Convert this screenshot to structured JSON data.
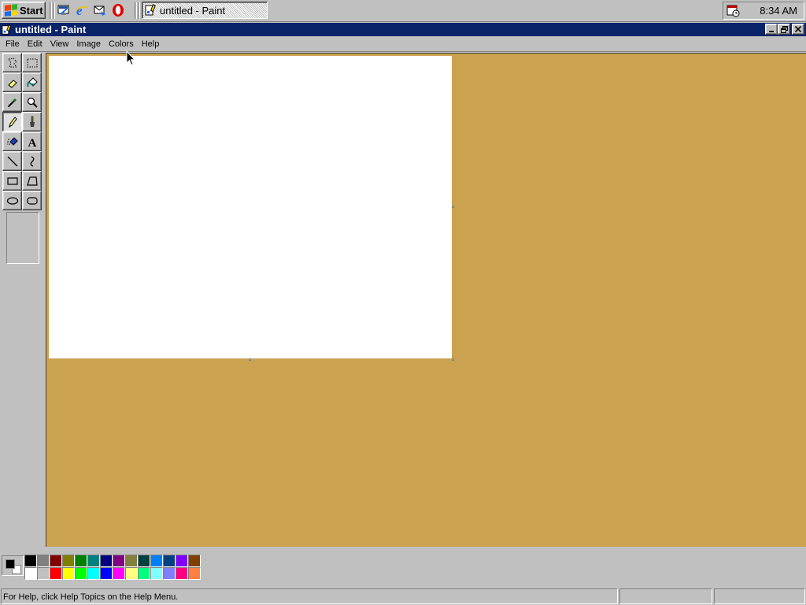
{
  "taskbar": {
    "start_label": "Start",
    "quick_launch": [
      "show-desktop-icon",
      "internet-explorer-icon",
      "outlook-express-icon",
      "opera-icon"
    ],
    "tasks": [
      {
        "label": "untitled - Paint",
        "active": true
      }
    ],
    "clock": "8:34 AM"
  },
  "window": {
    "title": "untitled - Paint",
    "controls": [
      "minimize",
      "restore",
      "close"
    ]
  },
  "menubar": {
    "items": [
      "File",
      "Edit",
      "View",
      "Image",
      "Colors",
      "Help"
    ]
  },
  "toolbox": {
    "tools": [
      "free-form-select",
      "select",
      "eraser",
      "fill-with-color",
      "pick-color",
      "magnifier",
      "pencil",
      "brush",
      "airbrush",
      "text",
      "line",
      "curve",
      "rectangle",
      "polygon",
      "ellipse",
      "rounded-rectangle"
    ],
    "selected_tool": "pencil"
  },
  "colors": {
    "canvas_background": "#cba24f",
    "foreground": "#000000",
    "background": "#ffffff",
    "palette": [
      "#000000",
      "#808080",
      "#800000",
      "#808000",
      "#008000",
      "#008080",
      "#000080",
      "#800080",
      "#808040",
      "#004040",
      "#0080ff",
      "#004080",
      "#8000ff",
      "#804000",
      "#ffffff",
      "#c0c0c0",
      "#ff0000",
      "#ffff00",
      "#00ff00",
      "#00ffff",
      "#0000ff",
      "#ff00ff",
      "#ffff80",
      "#00ff80",
      "#80ffff",
      "#8080ff",
      "#ff0080",
      "#ff8040"
    ]
  },
  "statusbar": {
    "help_text": "For Help, click Help Topics on the Help Menu.",
    "position": "",
    "size": ""
  }
}
